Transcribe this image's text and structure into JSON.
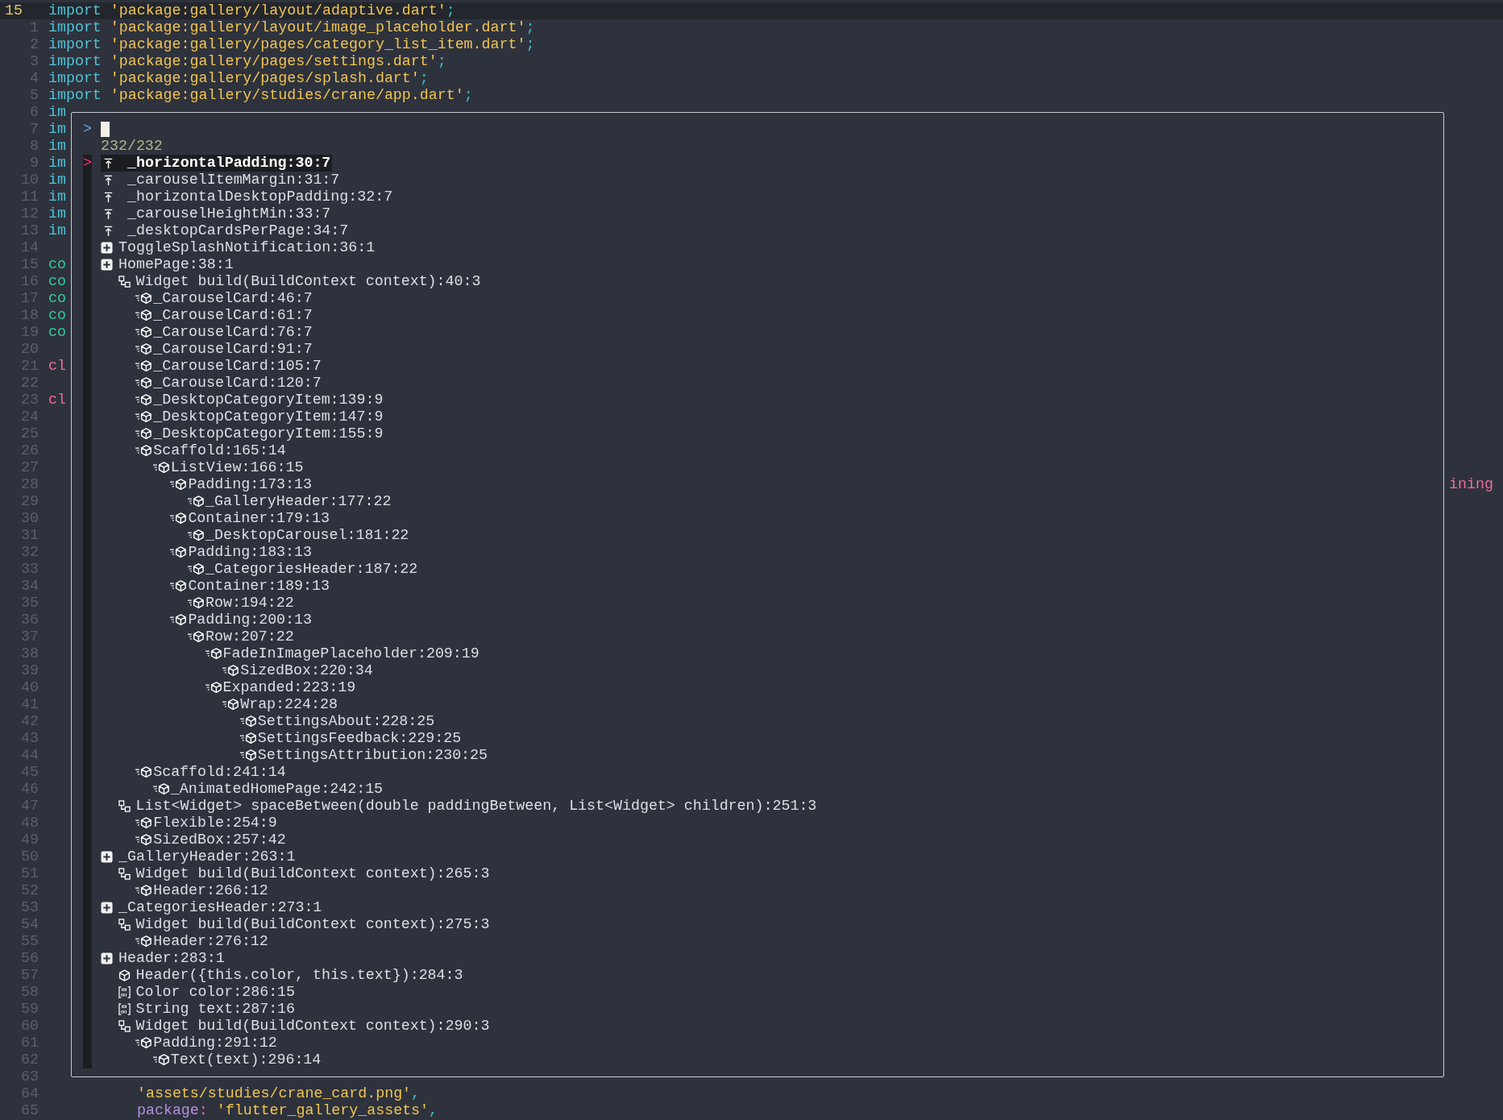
{
  "editor": {
    "lines": [
      {
        "number": "15",
        "current": true,
        "tokens": [
          {
            "text": "import",
            "kind": "keyword"
          },
          {
            "text": "'package:gallery/layout/adaptive.dart'",
            "kind": "string"
          },
          {
            "text": ";",
            "kind": "punct"
          }
        ]
      },
      {
        "number": "1",
        "current": false,
        "tokens": [
          {
            "text": "import",
            "kind": "keyword"
          },
          {
            "text": "'package:gallery/layout/image_placeholder.dart'",
            "kind": "string"
          },
          {
            "text": ";",
            "kind": "punct"
          }
        ]
      },
      {
        "number": "2",
        "current": false,
        "tokens": [
          {
            "text": "import",
            "kind": "keyword"
          },
          {
            "text": "'package:gallery/pages/category_list_item.dart'",
            "kind": "string"
          },
          {
            "text": ";",
            "kind": "punct"
          }
        ]
      },
      {
        "number": "3",
        "current": false,
        "tokens": [
          {
            "text": "import",
            "kind": "keyword"
          },
          {
            "text": "'package:gallery/pages/settings.dart'",
            "kind": "string"
          },
          {
            "text": ";",
            "kind": "punct"
          }
        ]
      },
      {
        "number": "4",
        "current": false,
        "tokens": [
          {
            "text": "import",
            "kind": "keyword"
          },
          {
            "text": "'package:gallery/pages/splash.dart'",
            "kind": "string"
          },
          {
            "text": ";",
            "kind": "punct"
          }
        ]
      },
      {
        "number": "5",
        "current": false,
        "tokens": [
          {
            "text": "import",
            "kind": "keyword"
          },
          {
            "text": "'package:gallery/studies/crane/app.dart'",
            "kind": "string"
          },
          {
            "text": ";",
            "kind": "punct"
          }
        ]
      },
      {
        "number": "6",
        "current": false,
        "tokens": [
          {
            "text": "im",
            "kind": "keyword"
          }
        ]
      },
      {
        "number": "7",
        "current": false,
        "tokens": [
          {
            "text": "im",
            "kind": "keyword"
          }
        ]
      },
      {
        "number": "8",
        "current": false,
        "tokens": [
          {
            "text": "im",
            "kind": "keyword"
          }
        ]
      },
      {
        "number": "9",
        "current": false,
        "tokens": [
          {
            "text": "im",
            "kind": "keyword"
          }
        ]
      },
      {
        "number": "10",
        "current": false,
        "tokens": [
          {
            "text": "im",
            "kind": "keyword"
          }
        ]
      },
      {
        "number": "11",
        "current": false,
        "tokens": [
          {
            "text": "im",
            "kind": "keyword"
          }
        ]
      },
      {
        "number": "12",
        "current": false,
        "tokens": [
          {
            "text": "im",
            "kind": "keyword"
          }
        ]
      },
      {
        "number": "13",
        "current": false,
        "tokens": [
          {
            "text": "im",
            "kind": "keyword"
          }
        ]
      },
      {
        "number": "14",
        "current": false
      },
      {
        "number": "15",
        "current": false,
        "tokens": [
          {
            "text": "co",
            "kind": "modifier"
          }
        ]
      },
      {
        "number": "16",
        "current": false,
        "tokens": [
          {
            "text": "co",
            "kind": "modifier"
          }
        ]
      },
      {
        "number": "17",
        "current": false,
        "tokens": [
          {
            "text": "co",
            "kind": "modifier"
          }
        ]
      },
      {
        "number": "18",
        "current": false,
        "tokens": [
          {
            "text": "co",
            "kind": "modifier"
          }
        ]
      },
      {
        "number": "19",
        "current": false,
        "tokens": [
          {
            "text": "co",
            "kind": "modifier"
          }
        ]
      },
      {
        "number": "20",
        "current": false
      },
      {
        "number": "21",
        "current": false,
        "tokens": [
          {
            "text": "cl",
            "kind": "storage"
          }
        ]
      },
      {
        "number": "22",
        "current": false
      },
      {
        "number": "23",
        "current": false,
        "tokens": [
          {
            "text": "cl",
            "kind": "storage"
          }
        ]
      },
      {
        "number": "24",
        "current": false
      },
      {
        "number": "25",
        "current": false
      },
      {
        "number": "26",
        "current": false
      },
      {
        "number": "27",
        "current": false
      },
      {
        "number": "28",
        "current": false,
        "tail": true,
        "tokens": [
          {
            "text": "ining",
            "kind": "storage"
          }
        ]
      },
      {
        "number": "29",
        "current": false
      },
      {
        "number": "30",
        "current": false
      },
      {
        "number": "31",
        "current": false
      },
      {
        "number": "32",
        "current": false
      },
      {
        "number": "33",
        "current": false
      },
      {
        "number": "34",
        "current": false
      },
      {
        "number": "35",
        "current": false
      },
      {
        "number": "36",
        "current": false
      },
      {
        "number": "37",
        "current": false
      },
      {
        "number": "38",
        "current": false
      },
      {
        "number": "39",
        "current": false
      },
      {
        "number": "40",
        "current": false
      },
      {
        "number": "41",
        "current": false
      },
      {
        "number": "42",
        "current": false
      },
      {
        "number": "43",
        "current": false
      },
      {
        "number": "44",
        "current": false
      },
      {
        "number": "45",
        "current": false
      },
      {
        "number": "46",
        "current": false
      },
      {
        "number": "47",
        "current": false
      },
      {
        "number": "48",
        "current": false
      },
      {
        "number": "49",
        "current": false
      },
      {
        "number": "50",
        "current": false
      },
      {
        "number": "51",
        "current": false
      },
      {
        "number": "52",
        "current": false
      },
      {
        "number": "53",
        "current": false
      },
      {
        "number": "54",
        "current": false
      },
      {
        "number": "55",
        "current": false
      },
      {
        "number": "56",
        "current": false
      },
      {
        "number": "57",
        "current": false
      },
      {
        "number": "58",
        "current": false
      },
      {
        "number": "59",
        "current": false
      },
      {
        "number": "60",
        "current": false
      },
      {
        "number": "61",
        "current": false
      },
      {
        "number": "62",
        "current": false
      },
      {
        "number": "63",
        "current": false
      },
      {
        "number": "64",
        "current": false,
        "nested": true,
        "tokens": [
          {
            "text": "'assets/studies/crane_card.png'",
            "kind": "string"
          },
          {
            "text": ",",
            "kind": "punct"
          }
        ]
      },
      {
        "number": "65",
        "current": false,
        "nested": true,
        "tokens": [
          {
            "text": "package",
            "kind": "property"
          },
          {
            "text": ":",
            "kind": "colon"
          },
          {
            "text": "'flutter_gallery_assets'",
            "kind": "string"
          },
          {
            "text": ",",
            "kind": "punct"
          }
        ]
      }
    ]
  },
  "picker": {
    "prompt": ">",
    "count": "232/232",
    "marker": ">",
    "symbols": [
      {
        "kind": "const",
        "label": "_horizontalPadding:30:7",
        "selected": true
      },
      {
        "kind": "const",
        "label": "_carouselItemMargin:31:7",
        "selected": false
      },
      {
        "kind": "const",
        "label": "_horizontalDesktopPadding:32:7",
        "selected": false
      },
      {
        "kind": "const",
        "label": "_carouselHeightMin:33:7",
        "selected": false
      },
      {
        "kind": "const",
        "label": "_desktopCardsPerPage:34:7",
        "selected": false
      },
      {
        "kind": "class",
        "label": "ToggleSplashNotification:36:1",
        "selected": false
      },
      {
        "kind": "class",
        "label": "HomePage:38:1",
        "selected": false,
        "children": [
          {
            "kind": "method",
            "label": "Widget build(BuildContext context):40:3",
            "selected": false,
            "children": [
              {
                "kind": "call",
                "label": "_CarouselCard:46:7",
                "selected": false
              },
              {
                "kind": "call",
                "label": "_CarouselCard:61:7",
                "selected": false
              },
              {
                "kind": "call",
                "label": "_CarouselCard:76:7",
                "selected": false
              },
              {
                "kind": "call",
                "label": "_CarouselCard:91:7",
                "selected": false
              },
              {
                "kind": "call",
                "label": "_CarouselCard:105:7",
                "selected": false
              },
              {
                "kind": "call",
                "label": "_CarouselCard:120:7",
                "selected": false
              },
              {
                "kind": "call",
                "label": "_DesktopCategoryItem:139:9",
                "selected": false
              },
              {
                "kind": "call",
                "label": "_DesktopCategoryItem:147:9",
                "selected": false
              },
              {
                "kind": "call",
                "label": "_DesktopCategoryItem:155:9",
                "selected": false
              },
              {
                "kind": "call",
                "label": "Scaffold:165:14",
                "selected": false,
                "children": [
                  {
                    "kind": "call",
                    "label": "ListView:166:15",
                    "selected": false,
                    "children": [
                      {
                        "kind": "call",
                        "label": "Padding:173:13",
                        "selected": false,
                        "children": [
                          {
                            "kind": "call",
                            "label": "_GalleryHeader:177:22",
                            "selected": false
                          }
                        ]
                      },
                      {
                        "kind": "call",
                        "label": "Container:179:13",
                        "selected": false,
                        "children": [
                          {
                            "kind": "call",
                            "label": "_DesktopCarousel:181:22",
                            "selected": false
                          }
                        ]
                      },
                      {
                        "kind": "call",
                        "label": "Padding:183:13",
                        "selected": false,
                        "children": [
                          {
                            "kind": "call",
                            "label": "_CategoriesHeader:187:22",
                            "selected": false
                          }
                        ]
                      },
                      {
                        "kind": "call",
                        "label": "Container:189:13",
                        "selected": false,
                        "children": [
                          {
                            "kind": "call",
                            "label": "Row:194:22",
                            "selected": false
                          }
                        ]
                      },
                      {
                        "kind": "call",
                        "label": "Padding:200:13",
                        "selected": false,
                        "children": [
                          {
                            "kind": "call",
                            "label": "Row:207:22",
                            "selected": false,
                            "children": [
                              {
                                "kind": "call",
                                "label": "FadeInImagePlaceholder:209:19",
                                "selected": false,
                                "children": [
                                  {
                                    "kind": "call",
                                    "label": "SizedBox:220:34",
                                    "selected": false
                                  }
                                ]
                              },
                              {
                                "kind": "call",
                                "label": "Expanded:223:19",
                                "selected": false,
                                "children": [
                                  {
                                    "kind": "call",
                                    "label": "Wrap:224:28",
                                    "selected": false,
                                    "children": [
                                      {
                                        "kind": "call",
                                        "label": "SettingsAbout:228:25",
                                        "selected": false
                                      },
                                      {
                                        "kind": "call",
                                        "label": "SettingsFeedback:229:25",
                                        "selected": false
                                      },
                                      {
                                        "kind": "call",
                                        "label": "SettingsAttribution:230:25",
                                        "selected": false
                                      }
                                    ]
                                  }
                                ]
                              }
                            ]
                          }
                        ]
                      }
                    ]
                  }
                ]
              },
              {
                "kind": "call",
                "label": "Scaffold:241:14",
                "selected": false,
                "children": [
                  {
                    "kind": "call",
                    "label": "_AnimatedHomePage:242:15",
                    "selected": false
                  }
                ]
              }
            ]
          },
          {
            "kind": "method",
            "label": "List<Widget> spaceBetween(double paddingBetween, List<Widget> children):251:3",
            "selected": false,
            "children": [
              {
                "kind": "call",
                "label": "Flexible:254:9",
                "selected": false
              },
              {
                "kind": "call",
                "label": "SizedBox:257:42",
                "selected": false
              }
            ]
          }
        ]
      },
      {
        "kind": "class",
        "label": "_GalleryHeader:263:1",
        "selected": false,
        "children": [
          {
            "kind": "method",
            "label": "Widget build(BuildContext context):265:3",
            "selected": false,
            "children": [
              {
                "kind": "call",
                "label": "Header:266:12",
                "selected": false
              }
            ]
          }
        ]
      },
      {
        "kind": "class",
        "label": "_CategoriesHeader:273:1",
        "selected": false,
        "children": [
          {
            "kind": "method",
            "label": "Widget build(BuildContext context):275:3",
            "selected": false,
            "children": [
              {
                "kind": "call",
                "label": "Header:276:12",
                "selected": false
              }
            ]
          }
        ]
      },
      {
        "kind": "class",
        "label": "Header:283:1",
        "selected": false,
        "children": [
          {
            "kind": "constructor",
            "label": "Header({this.color, this.text}):284:3",
            "selected": false
          },
          {
            "kind": "field",
            "label": "Color color:286:15",
            "selected": false
          },
          {
            "kind": "field",
            "label": "String text:287:16",
            "selected": false
          },
          {
            "kind": "method",
            "label": "Widget build(BuildContext context):290:3",
            "selected": false,
            "children": [
              {
                "kind": "call",
                "label": "Padding:291:12",
                "selected": false,
                "children": [
                  {
                    "kind": "call",
                    "label": "Text(text):296:14",
                    "selected": false
                  }
                ]
              }
            ]
          }
        ]
      }
    ]
  }
}
